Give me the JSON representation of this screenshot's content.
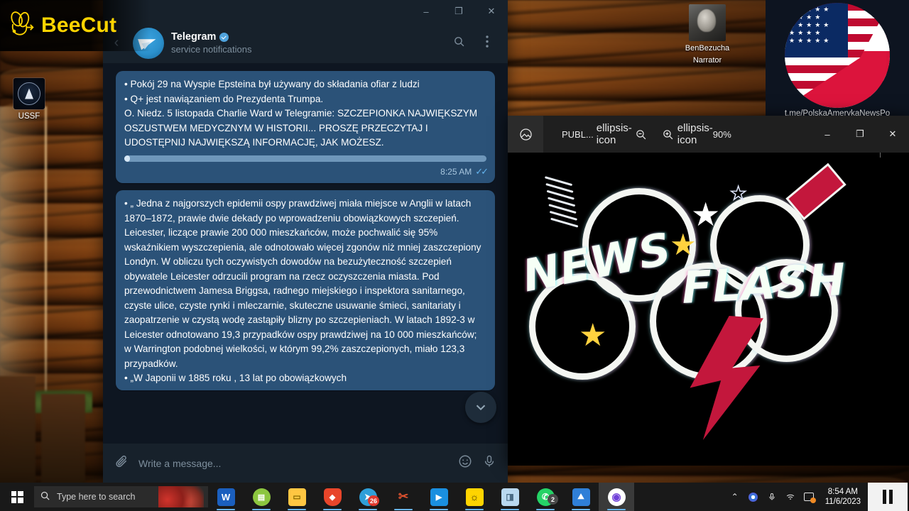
{
  "watermark": {
    "app_name": "BeeCut",
    "icon": "bee-icon"
  },
  "desktop": {
    "icons": [
      {
        "label": "USSF",
        "icon": "space-force-icon"
      }
    ],
    "overlay_person": {
      "name_line1": "BenBezucha",
      "name_line2": "Narrator",
      "icon": "portrait-avatar"
    },
    "channel_logo": {
      "url_text": "t.me/PolskaAmerykaNewsPo",
      "icon": "us-poland-flag-icon"
    }
  },
  "telegram": {
    "window_controls": {
      "minimize": "–",
      "maximize": "❐",
      "close": "✕"
    },
    "back_icon": "back-arrow-icon",
    "chat_title": "Telegram",
    "verified": true,
    "chat_subtitle": "service notifications",
    "search_icon": "search-icon",
    "menu_icon": "more-vertical-icon",
    "messages": [
      {
        "lines": [
          "•  Pokój 29 na Wyspie Epsteina był używany do składania ofiar z ludzi",
          "•  Q+ jest nawiązaniem do Prezydenta Trumpa.",
          "O. Niedz. 5 listopada Charlie Ward w Telegramie: SZCZEPIONKA NAJWIĘKSZYM OSZUSTWEM MEDYCZNYM W HISTORII... PROSZĘ PRZECZYTAJ I UDOSTĘPNIJ NAJWIĘKSZĄ INFORMACJĘ, JAK MOŻESZ."
        ],
        "has_progress_bar": true,
        "time": "8:25 AM",
        "status_icon": "double-check-icon"
      },
      {
        "lines": [
          "•  „ Jedna z najgorszych epidemii ospy prawdziwej miała miejsce w Anglii w latach 1870–1872, prawie dwie dekady po wprowadzeniu obowiązkowych szczepień. Leicester, liczące prawie 200 000 mieszkańców, może pochwalić się 95% wskaźnikiem wyszczepienia, ale odnotowało więcej zgonów niż mniej zaszczepiony Londyn. W obliczu tych oczywistych dowodów na bezużyteczność szczepień obywatele Leicester odrzucili program na rzecz oczyszczenia miasta. Pod przewodnictwem Jamesa Briggsa, radnego miejskiego i inspektora sanitarnego, czyste ulice, czyste rynki i mleczarnie, skuteczne usuwanie śmieci, sanitariaty i zaopatrzenie w czystą wodę zastąpiły blizny po szczepieniach. W latach 1892-3 w Leicester odnotowano 19,3 przypadków ospy prawdziwej na 10 000 mieszkańców; w Warrington podobnej wielkości, w którym 99,2% zaszczepionych, miało 123,3 przypadków.",
          "•  „W Japonii w 1885 roku , 13 lat po obowiązkowych"
        ],
        "has_progress_bar": false
      }
    ],
    "scroll_down_icon": "chevron-down-icon",
    "composer": {
      "attach_icon": "paperclip-icon",
      "placeholder": "Write a message...",
      "emoji_icon": "smiley-icon",
      "mic_icon": "microphone-icon"
    }
  },
  "photo_viewer": {
    "app_icon": "photos-app-icon",
    "title": "PUBL...",
    "more_icon_left": "ellipsis-icon",
    "zoom_out_icon": "zoom-out-icon",
    "zoom_in_icon": "zoom-in-icon",
    "more_icon_right": "ellipsis-icon",
    "zoom_level": "90%",
    "window_controls": {
      "minimize": "–",
      "maximize": "❐",
      "close": "✕"
    },
    "image_content": {
      "text_line1": "NEWS",
      "text_line2": "FLASH",
      "icon": "news-flash-burst-icon"
    }
  },
  "taskbar": {
    "start_icon": "windows-start-icon",
    "search": {
      "icon": "search-icon",
      "placeholder": "Type here to search"
    },
    "items": [
      {
        "name": "word",
        "glyph": "W",
        "color": "#1b5fbe",
        "badge": null,
        "active": false
      },
      {
        "name": "green-cloud-app",
        "glyph": "●",
        "color": "#8cc63f",
        "badge": null,
        "active": false
      },
      {
        "name": "file-explorer",
        "glyph": "▭",
        "color": "#ffc642",
        "badge": null,
        "active": false
      },
      {
        "name": "brave-browser",
        "glyph": "◆",
        "color": "#e8452a",
        "badge": null,
        "active": false
      },
      {
        "name": "telegram",
        "glyph": "➤",
        "color": "#2f9fd8",
        "badge": "26",
        "active": false
      },
      {
        "name": "snipping-tool",
        "glyph": "✂",
        "color": "#e0522f",
        "badge": null,
        "active": false
      },
      {
        "name": "movies-and-tv",
        "glyph": "▶",
        "color": "#1a8fe0",
        "badge": null,
        "active": false
      },
      {
        "name": "beecut",
        "glyph": "♛",
        "color": "#ffd400",
        "badge": null,
        "active": false
      },
      {
        "name": "onenote",
        "glyph": "◧",
        "color": "#b9d8ef",
        "badge": null,
        "active": false
      },
      {
        "name": "whatsapp",
        "glyph": "✆",
        "color": "#25d366",
        "badge": "2",
        "active": false
      },
      {
        "name": "photos",
        "glyph": "⛰",
        "color": "#2f7fd8",
        "badge": null,
        "active": false
      },
      {
        "name": "opera-browser",
        "glyph": "◎",
        "color": "#6f3fd8",
        "badge": null,
        "active": true
      }
    ],
    "tray": {
      "chevron_icon": "chevron-up-icon",
      "cortana_icon": "assistant-icon",
      "mic_icon": "microphone-icon",
      "wifi_icon": "wifi-icon",
      "action_center_icon": "action-center-icon"
    },
    "clock": {
      "time": "8:54 AM",
      "date": "11/6/2023"
    },
    "recorder": {
      "pause_icon": "pause-icon"
    }
  }
}
